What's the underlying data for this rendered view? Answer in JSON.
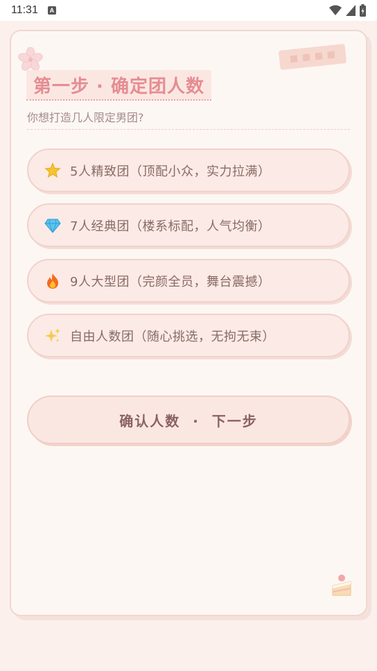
{
  "status_bar": {
    "time": "11:31",
    "notif_letter": "A"
  },
  "page": {
    "title": "第一步 · 确定团人数",
    "subtitle": "你想打造几人限定男团?"
  },
  "options": [
    {
      "icon": "star-icon",
      "label": "5人精致团（顶配小众，实力拉满）"
    },
    {
      "icon": "diamond-icon",
      "label": "7人经典团（楼系标配，人气均衡）"
    },
    {
      "icon": "fire-icon",
      "label": "9人大型团（完颜全员，舞台震撼）"
    },
    {
      "icon": "sparkles-icon",
      "label": "自由人数团（随心挑选，无拘无束）"
    }
  ],
  "confirm_button": {
    "label": "确认人数  ·  下一步"
  },
  "colors": {
    "background": "#fcf0ec",
    "card": "#fdf7f4",
    "title": "#e58d92",
    "text": "#8a6a66",
    "border": "#f0d2cb"
  }
}
